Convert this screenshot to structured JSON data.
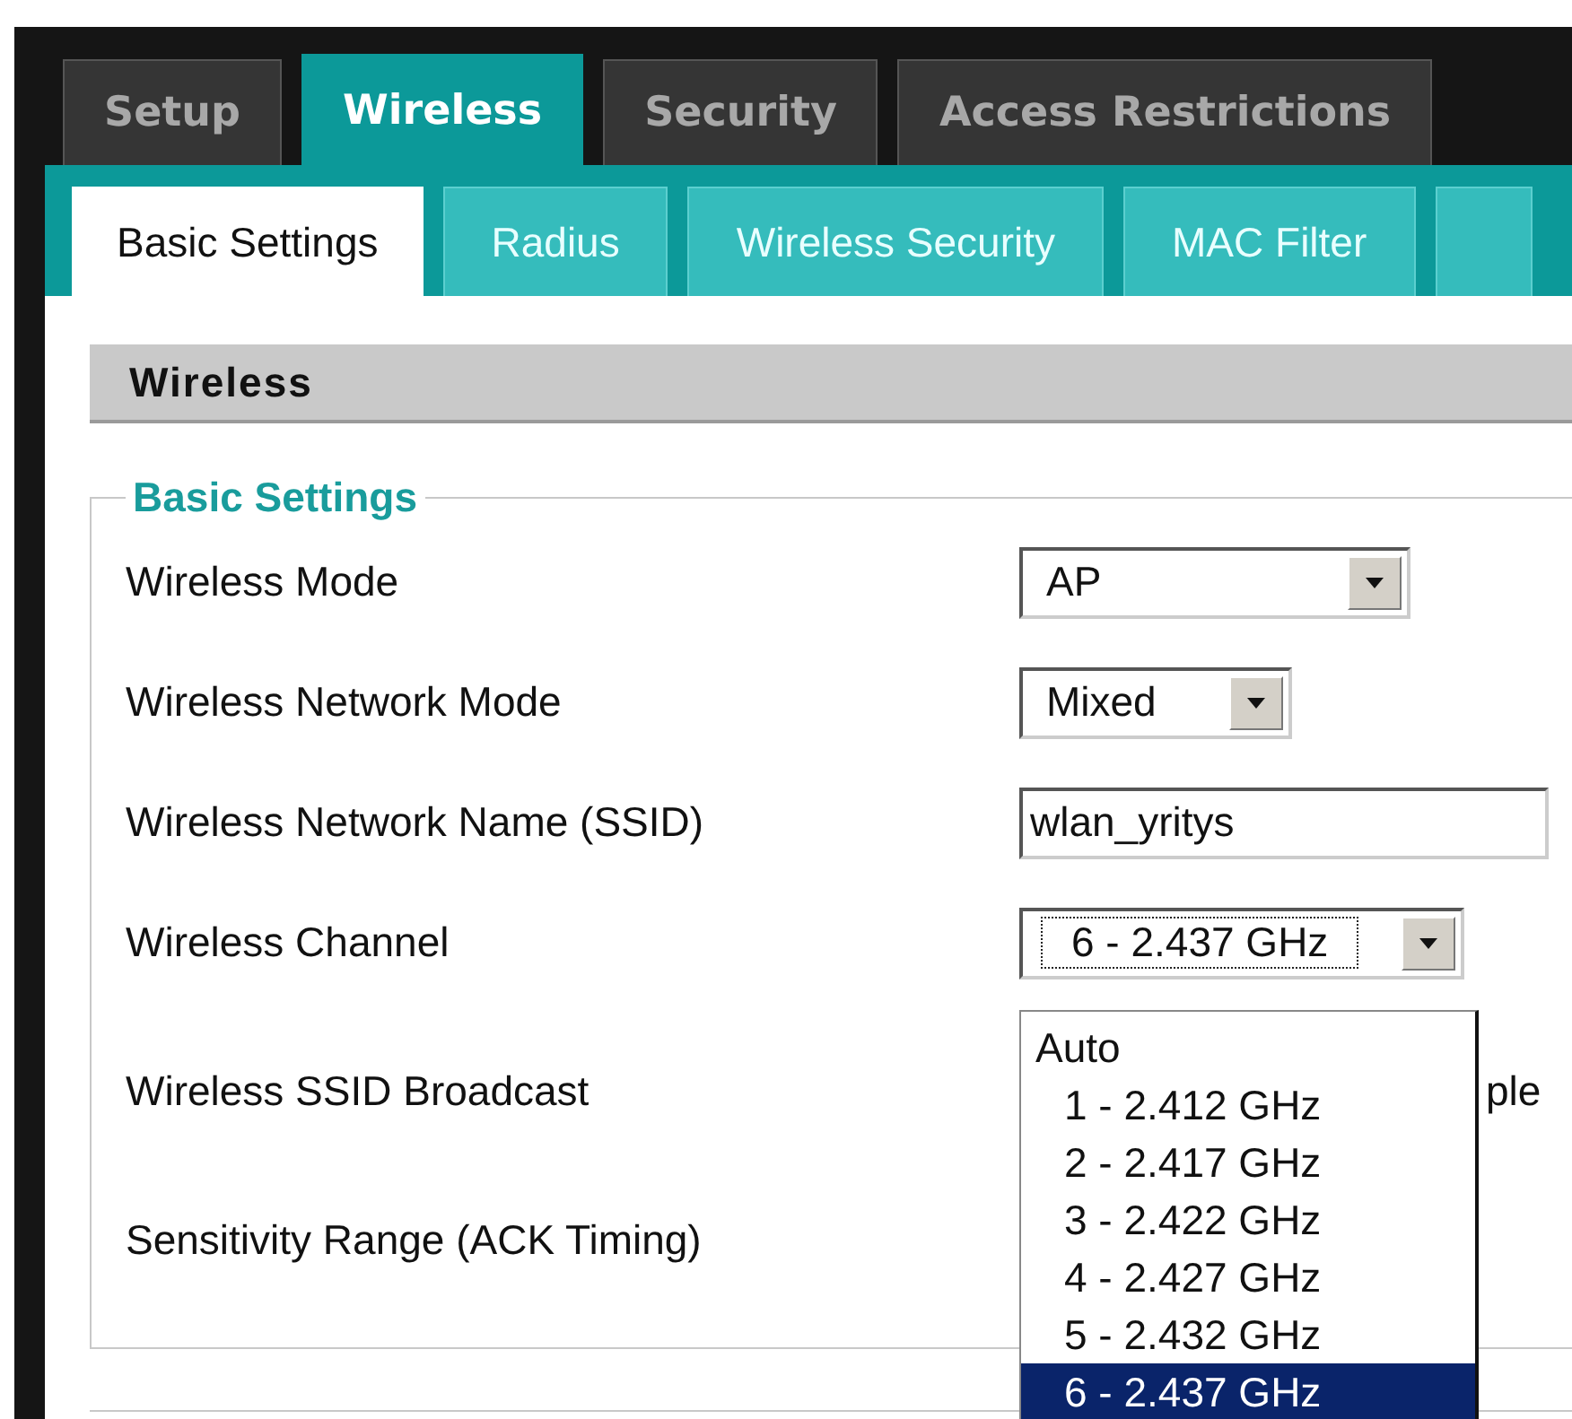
{
  "main_tabs": [
    {
      "label": "Setup",
      "selected": false
    },
    {
      "label": "Wireless",
      "selected": true
    },
    {
      "label": "Security",
      "selected": false
    },
    {
      "label": "Access Restrictions",
      "selected": false
    }
  ],
  "sub_tabs": [
    {
      "label": "Basic Settings",
      "selected": true
    },
    {
      "label": "Radius",
      "selected": false
    },
    {
      "label": "Wireless Security",
      "selected": false
    },
    {
      "label": "MAC Filter",
      "selected": false
    },
    {
      "selected": false
    }
  ],
  "section_title": "Wireless",
  "fieldset": {
    "legend": "Basic Settings",
    "rows": [
      {
        "label": "Wireless Mode",
        "kind": "select",
        "value": "AP"
      },
      {
        "label": "Wireless Network Mode",
        "kind": "select",
        "value": "Mixed"
      },
      {
        "label": "Wireless Network Name (SSID)",
        "kind": "input",
        "value": "wlan_yritys"
      },
      {
        "label": "Wireless Channel",
        "kind": "select",
        "value": "6 - 2.437 GHz",
        "focused": true
      },
      {
        "label": "Wireless SSID Broadcast",
        "kind": "radio",
        "text": "ple"
      },
      {
        "label": "Sensitivity Range (ACK Timing)",
        "kind": "hidden"
      }
    ]
  },
  "channel_dropdown": {
    "open": true,
    "options": [
      {
        "label": "Auto",
        "kind": "auto",
        "selected": false
      },
      {
        "label": "1 - 2.412 GHz",
        "kind": "channel",
        "selected": false
      },
      {
        "label": "2 - 2.417 GHz",
        "kind": "channel",
        "selected": false
      },
      {
        "label": "3 - 2.422 GHz",
        "kind": "channel",
        "selected": false
      },
      {
        "label": "4 - 2.427 GHz",
        "kind": "channel",
        "selected": false
      },
      {
        "label": "5 - 2.432 GHz",
        "kind": "channel",
        "selected": false
      },
      {
        "label": "6 - 2.437 GHz",
        "kind": "channel",
        "selected": true
      }
    ]
  }
}
